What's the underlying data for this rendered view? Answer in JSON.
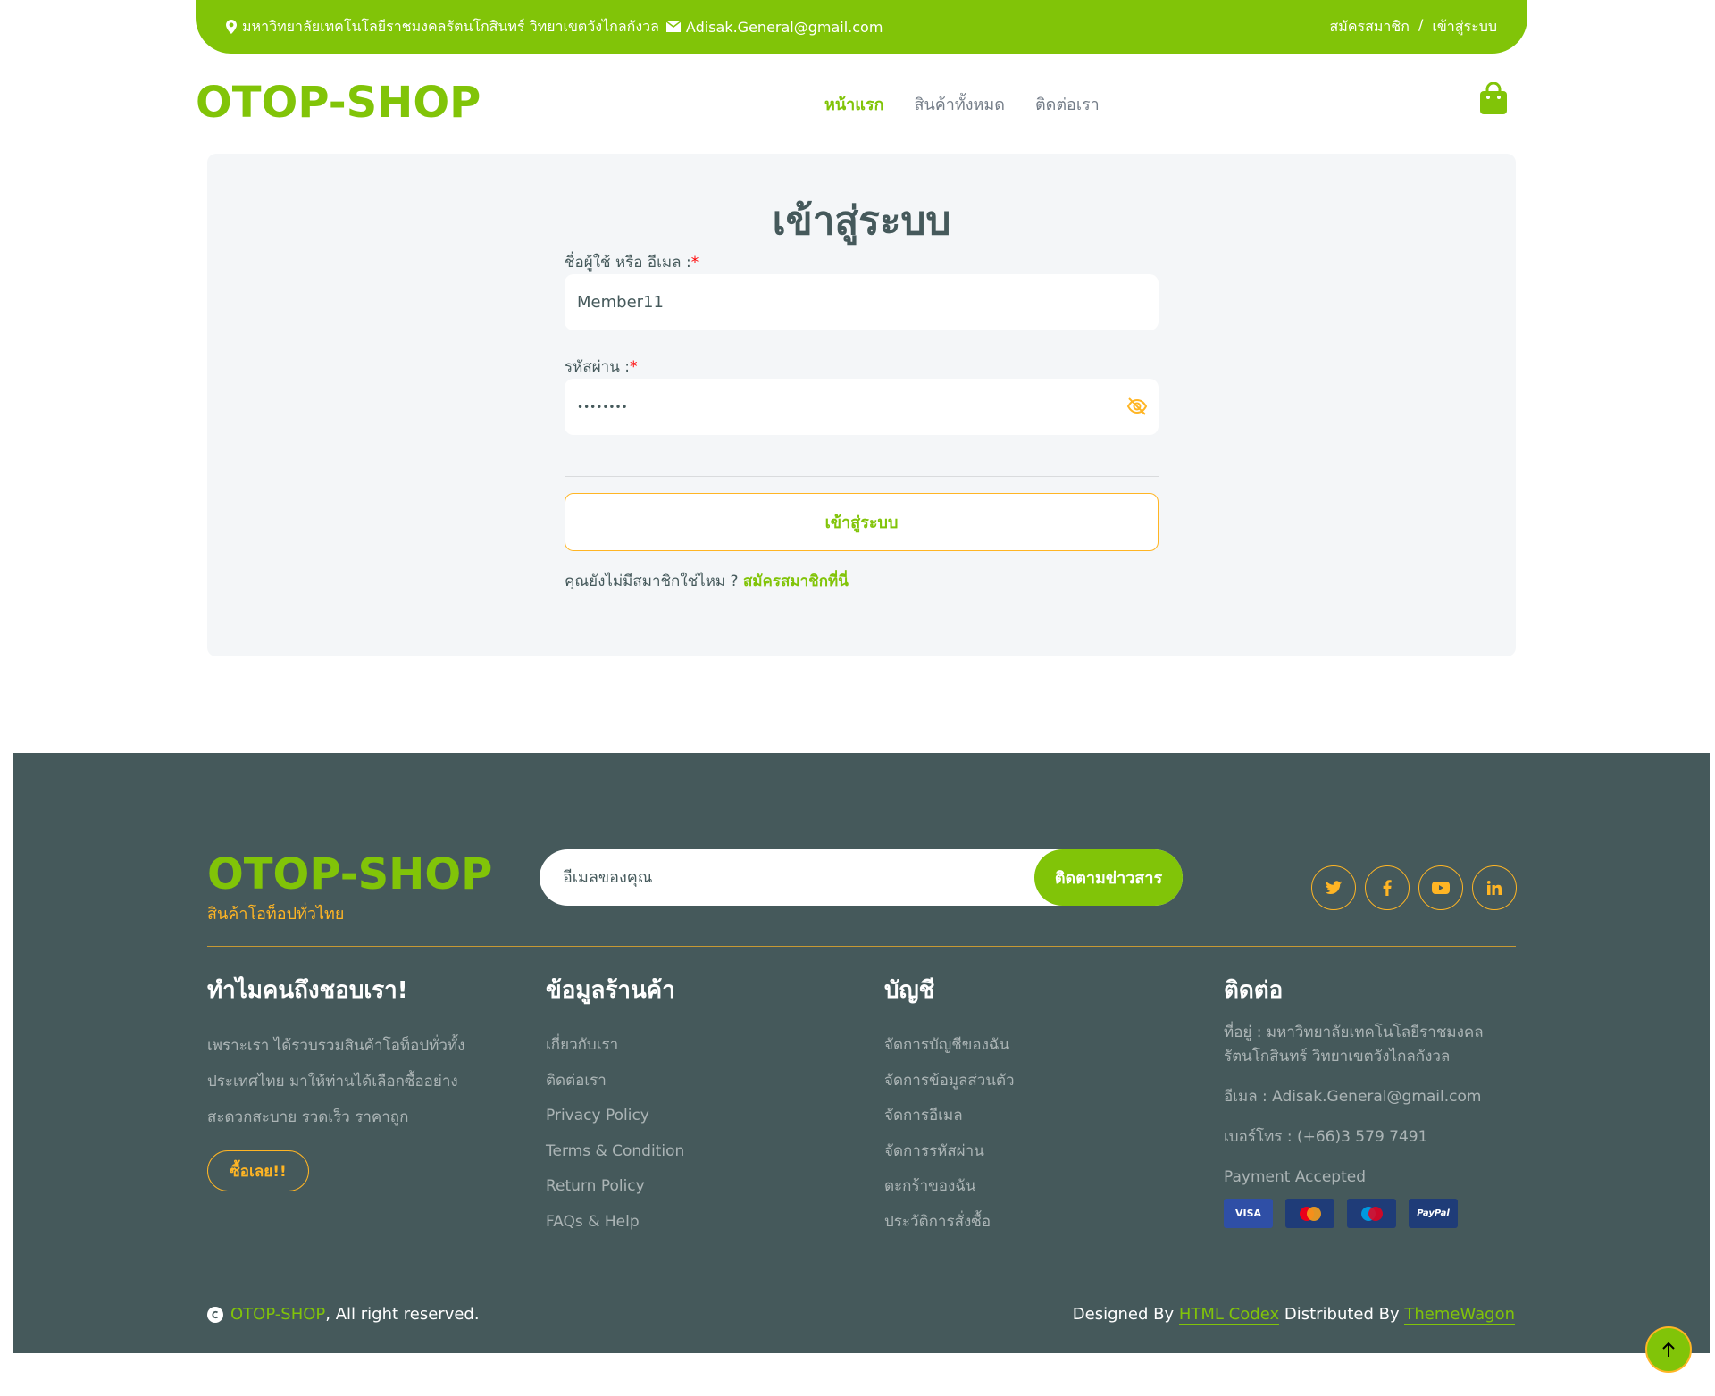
{
  "topbar": {
    "address": "มหาวิทยาลัยเทคโนโลยีราชมงคลรัตนโกสินทร์ วิทยาเขตวังไกลกังวล",
    "email": "Adisak.General@gmail.com",
    "register": "สมัครสมาชิก",
    "separator": "/",
    "login": "เข้าสู่ระบบ"
  },
  "header": {
    "logo": "OTOP-SHOP",
    "nav": [
      "หน้าแรก",
      "สินค้าทั้งหมด",
      "ติดต่อเรา"
    ]
  },
  "login": {
    "title": "เข้าสู่ระบบ",
    "username_label": "ชื่อผู้ใช้ หรือ อีเมล :",
    "username_value": "Member11",
    "password_label": "รหัสผ่าน :",
    "password_value": "••••••••",
    "required_mark": "*",
    "submit": "เข้าสู่ระบบ",
    "no_account": "คุณยังไม่มีสมาชิกใช่ไหม ?",
    "register_link": "สมัครสมาชิกที่นี่"
  },
  "footer": {
    "logo": "OTOP-SHOP",
    "tagline": "สินค้าโอท็อปทั่วไทย",
    "subscribe_placeholder": "อีเมลของคุณ",
    "subscribe_button": "ติดตามข่าวสาร",
    "socials": [
      "twitter-icon",
      "facebook-icon",
      "youtube-icon",
      "linkedin-icon"
    ],
    "col1": {
      "title": "ทำไมคนถึงชอบเรา!",
      "text1": "เพราะเรา ได้รวบรวมสินค้าโอท็อปทั่วทั้ง",
      "text2": "ประเทศไทย มาให้ท่านได้เลือกซื้ออย่าง",
      "text3": "สะดวกสะบาย รวดเร็ว ราคาถูก",
      "button": "ซื้อเลย!!"
    },
    "col2": {
      "title": "ข้อมูลร้านค้า",
      "links": [
        "เกี่ยวกับเรา",
        "ติดต่อเรา",
        "Privacy Policy",
        "Terms & Condition",
        "Return Policy",
        "FAQs & Help"
      ]
    },
    "col3": {
      "title": "บัญชี",
      "links": [
        "จัดการบัญชีของฉัน",
        "จัดการข้อมูลส่วนตัว",
        "จัดการอีเมล",
        "จัดการรหัสผ่าน",
        "ตะกร้าของฉัน",
        "ประวัติการสั่งซื้อ"
      ]
    },
    "col4": {
      "title": "ติดต่อ",
      "address": "ที่อยู่ : มหาวิทยาลัยเทคโนโลยีราชมงคล รัตนโกสินทร์ วิทยาเขตวังไกลกังวล",
      "email": "อีเมล : Adisak.General@gmail.com",
      "phone": "เบอร์โทร : (+66)3 579 7491",
      "payment": "Payment Accepted",
      "cards": [
        "VISA",
        "MasterCard",
        "Maestro",
        "PayPal"
      ]
    },
    "copyright_brand": "OTOP-SHOP",
    "copyright_text": ", All right reserved.",
    "designed_by": "Designed By",
    "designer": "HTML Codex",
    "distributed_by": "Distributed By",
    "distributor": "ThemeWagon"
  },
  "colors": {
    "primary": "#81c408",
    "secondary": "#ffb524",
    "dark": "#45595b"
  }
}
